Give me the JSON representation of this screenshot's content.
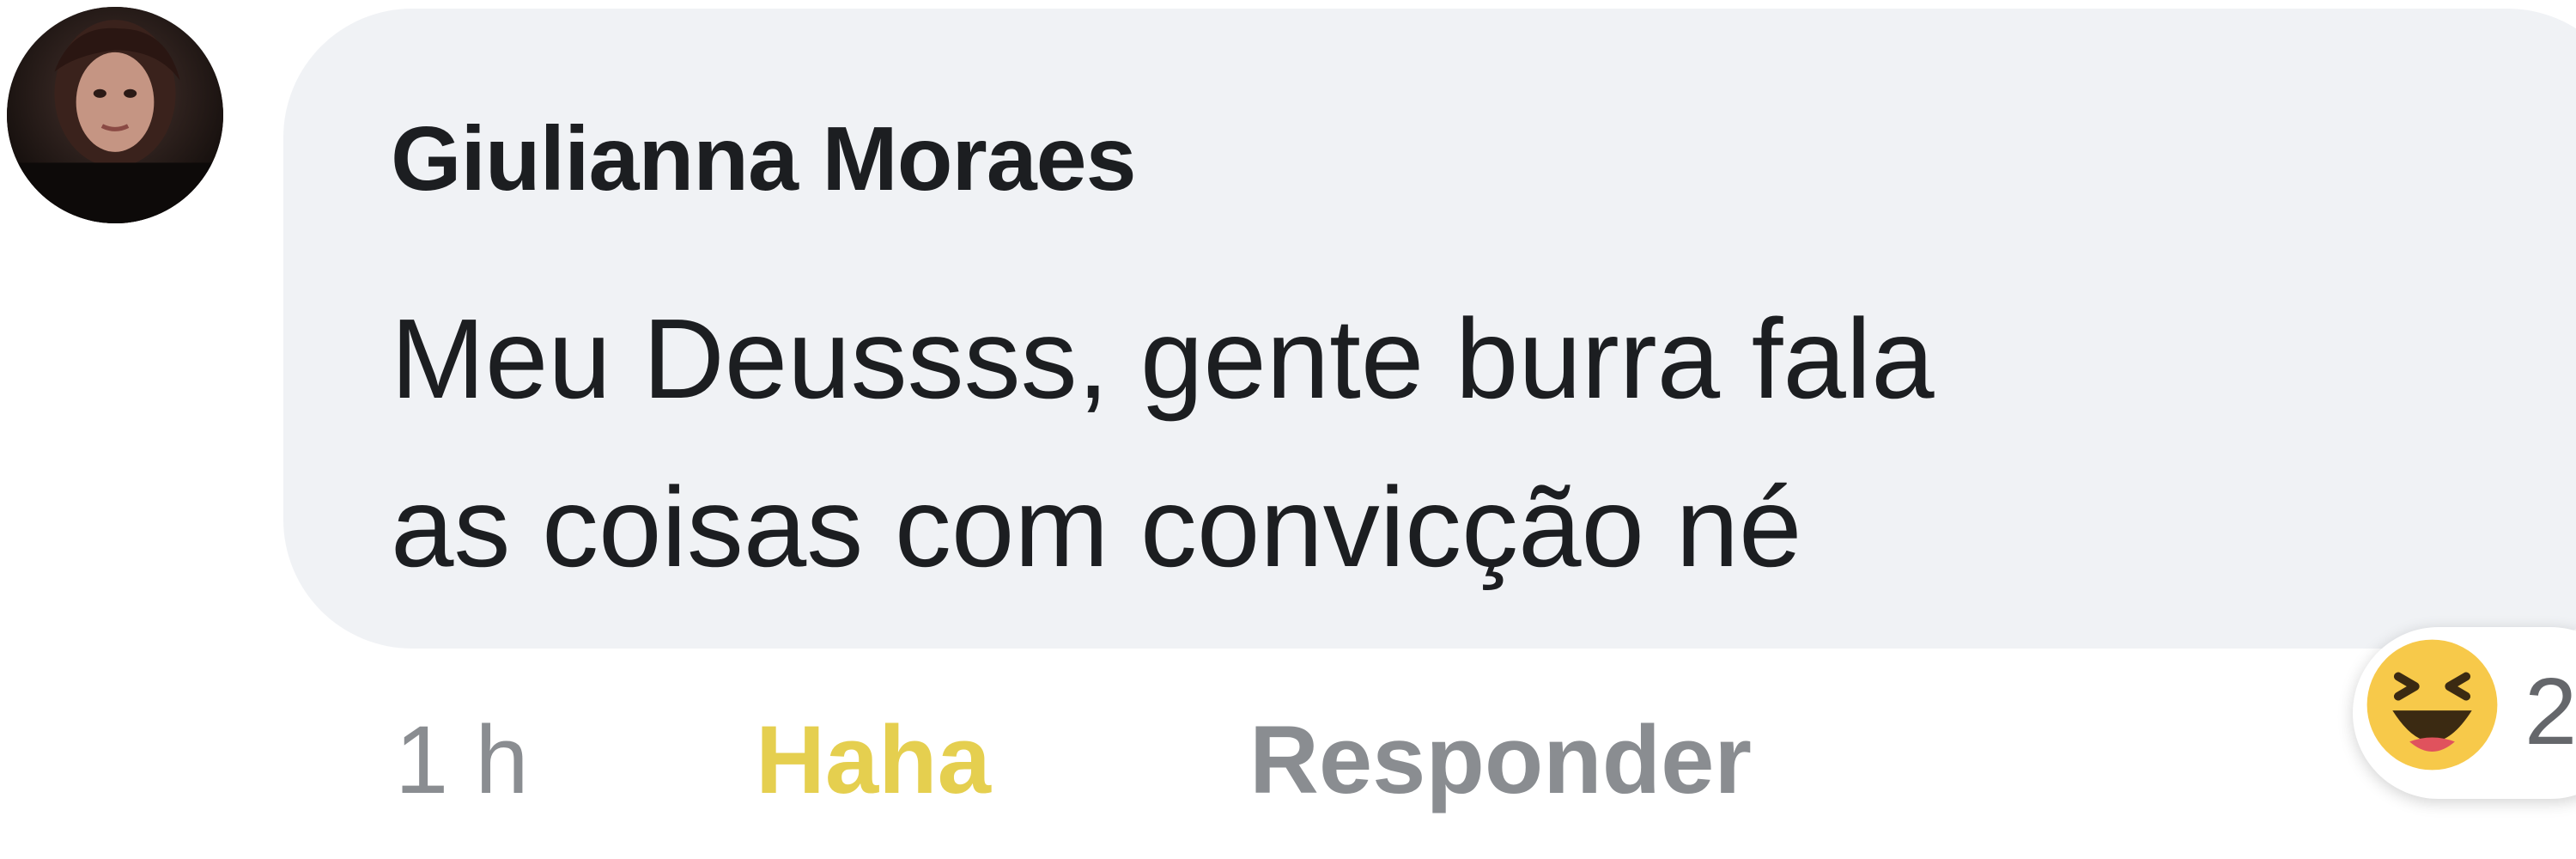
{
  "comment": {
    "author": "Giulianna Moraes",
    "text_lines": [
      "Meu Deussss, gente burra fala",
      "as coisas com convicção né"
    ]
  },
  "actions": {
    "time": "1 h",
    "reaction_label": "Haha",
    "reply_label": "Responder"
  },
  "reactions": {
    "icon": "haha-emoji-icon",
    "count": "2"
  },
  "colors": {
    "bubble": "#f0f2f5",
    "author": "#1c1e21",
    "meta_gray": "#8a8d91",
    "haha_yellow": "#e5cf4f",
    "emoji_yellow": "#f7c94a"
  }
}
